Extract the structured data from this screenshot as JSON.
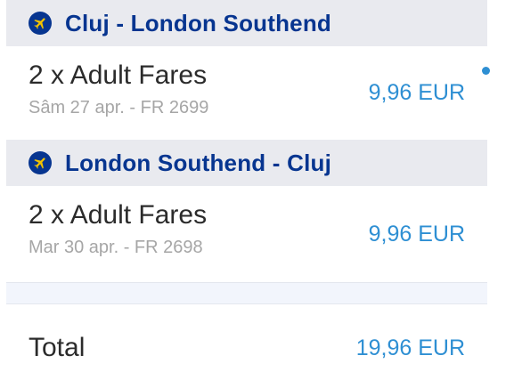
{
  "outbound": {
    "icon": "plane-icon",
    "route": "Cluj - London Southend",
    "fare_label": "2 x Adult Fares",
    "details": "Sâm 27 apr. - FR 2699",
    "price": "9,96 EUR"
  },
  "inbound": {
    "icon": "plane-icon",
    "route": "London Southend - Cluj",
    "fare_label": "2 x Adult Fares",
    "details": "Mar 30 apr. - FR 2698",
    "price": "9,96 EUR"
  },
  "total": {
    "label": "Total",
    "price": "19,96 EUR"
  },
  "colors": {
    "brand": "#073590",
    "price": "#2e8fd3",
    "header_bg": "#e9eaef"
  }
}
